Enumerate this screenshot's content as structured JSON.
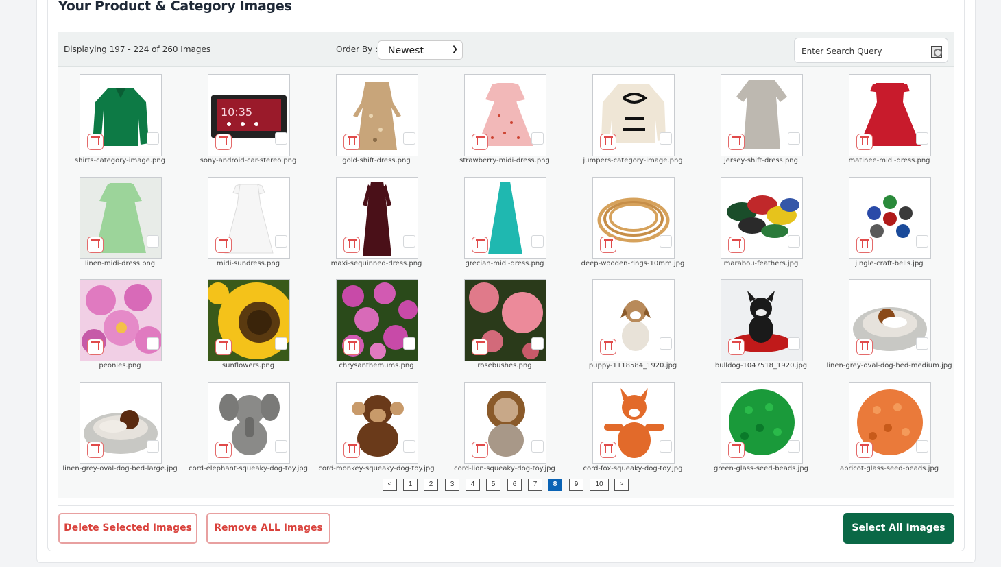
{
  "page": {
    "title": "Your Product & Category Images"
  },
  "toolbar": {
    "display_info": "Displaying 197 - 224 of 260 Images",
    "order_label": "Order By :",
    "order_value": "Newest",
    "search_placeholder": "Enter Search Query"
  },
  "images": [
    {
      "name": "shirts-category-image.png",
      "icon": "green-blouse"
    },
    {
      "name": "sony-android-car-stereo.png",
      "icon": "car-stereo"
    },
    {
      "name": "gold-shift-dress.png",
      "icon": "gold-dress"
    },
    {
      "name": "strawberry-midi-dress.png",
      "icon": "pink-dress"
    },
    {
      "name": "jumpers-category-image.png",
      "icon": "cream-jumper"
    },
    {
      "name": "jersey-shift-dress.png",
      "icon": "grey-dress"
    },
    {
      "name": "matinee-midi-dress.png",
      "icon": "red-dress"
    },
    {
      "name": "linen-midi-dress.png",
      "icon": "green-dress"
    },
    {
      "name": "midi-sundress.png",
      "icon": "white-dress"
    },
    {
      "name": "maxi-sequinned-dress.png",
      "icon": "burgundy-dress"
    },
    {
      "name": "grecian-midi-dress.png",
      "icon": "turquoise-dress"
    },
    {
      "name": "deep-wooden-rings-10mm.jpg",
      "icon": "wooden-rings"
    },
    {
      "name": "marabou-feathers.jpg",
      "icon": "feathers"
    },
    {
      "name": "jingle-craft-bells.jpg",
      "icon": "bells"
    },
    {
      "name": "peonies.png",
      "icon": "peonies"
    },
    {
      "name": "sunflowers.png",
      "icon": "sunflower"
    },
    {
      "name": "chrysanthemums.png",
      "icon": "chrysanthemums"
    },
    {
      "name": "rosebushes.png",
      "icon": "roses"
    },
    {
      "name": "puppy-1118584_1920.jpg",
      "icon": "puppy"
    },
    {
      "name": "bulldog-1047518_1920.jpg",
      "icon": "bulldog"
    },
    {
      "name": "linen-grey-oval-dog-bed-medium.jpg",
      "icon": "dog-bed-medium"
    },
    {
      "name": "linen-grey-oval-dog-bed-large.jpg",
      "icon": "dog-bed-large"
    },
    {
      "name": "cord-elephant-squeaky-dog-toy.jpg",
      "icon": "elephant-toy"
    },
    {
      "name": "cord-monkey-squeaky-dog-toy.jpg",
      "icon": "monkey-toy"
    },
    {
      "name": "cord-lion-squeaky-dog-toy.jpg",
      "icon": "lion-toy"
    },
    {
      "name": "cord-fox-squeaky-dog-toy.jpg",
      "icon": "fox-toy"
    },
    {
      "name": "green-glass-seed-beads.jpg",
      "icon": "green-beads"
    },
    {
      "name": "apricot-glass-seed-beads.jpg",
      "icon": "orange-beads"
    }
  ],
  "pagination": {
    "prev": "<",
    "pages": [
      "1",
      "2",
      "3",
      "4",
      "5",
      "6",
      "7",
      "8",
      "9",
      "10"
    ],
    "active": "8",
    "next": ">"
  },
  "actions": {
    "delete_selected": "Delete Selected Images",
    "remove_all": "Remove ALL Images",
    "select_all": "Select All Images"
  },
  "colors": {
    "primary": "#0a6846",
    "danger": "#d9413b",
    "active_page": "#0a63b5"
  }
}
